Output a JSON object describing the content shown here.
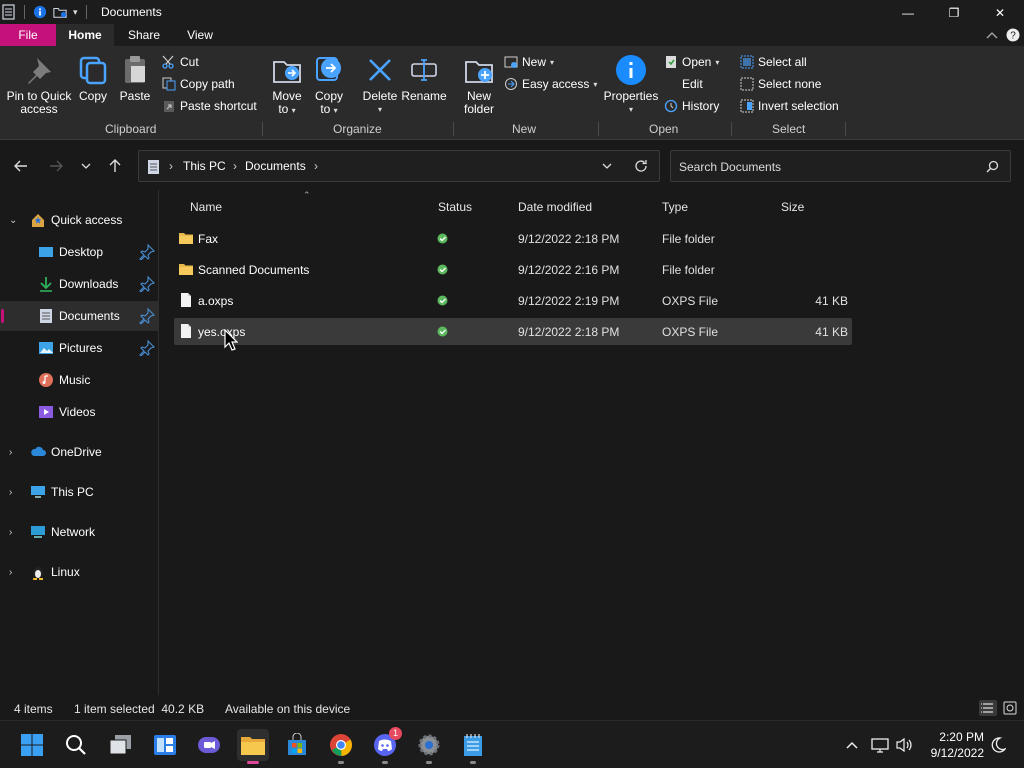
{
  "window": {
    "title": "Documents",
    "controls": {
      "minimize": "—",
      "maximize": "❐",
      "close": "✕"
    }
  },
  "ribbon": {
    "tabs": [
      "File",
      "Home",
      "Share",
      "View"
    ],
    "clipboard": {
      "label": "Clipboard",
      "pin": "Pin to Quick access",
      "copy": "Copy",
      "paste": "Paste",
      "cut": "Cut",
      "copy_path": "Copy path",
      "paste_shortcut": "Paste shortcut"
    },
    "organize": {
      "label": "Organize",
      "move_to_1": "Move",
      "move_to_2": "to",
      "copy_to_1": "Copy",
      "copy_to_2": "to",
      "delete": "Delete",
      "rename": "Rename"
    },
    "new": {
      "label": "New",
      "new_folder_1": "New",
      "new_folder_2": "folder",
      "new_item": "New",
      "easy_access": "Easy access"
    },
    "open": {
      "label": "Open",
      "properties": "Properties",
      "open": "Open",
      "edit": "Edit",
      "history": "History"
    },
    "select": {
      "label": "Select",
      "select_all": "Select all",
      "select_none": "Select none",
      "invert": "Invert selection"
    }
  },
  "address": {
    "crumbs": [
      "This PC",
      "Documents"
    ],
    "search_placeholder": "Search Documents"
  },
  "sidebar": {
    "items": [
      {
        "label": "Quick access",
        "icon": "star-icon"
      },
      {
        "label": "Desktop",
        "icon": "desktop-icon"
      },
      {
        "label": "Downloads",
        "icon": "download-icon"
      },
      {
        "label": "Documents",
        "icon": "document-icon"
      },
      {
        "label": "Pictures",
        "icon": "picture-icon"
      },
      {
        "label": "Music",
        "icon": "music-icon"
      },
      {
        "label": "Videos",
        "icon": "video-icon"
      },
      {
        "label": "OneDrive",
        "icon": "cloud-icon"
      },
      {
        "label": "This PC",
        "icon": "monitor-icon"
      },
      {
        "label": "Network",
        "icon": "network-icon"
      },
      {
        "label": "Linux",
        "icon": "linux-icon"
      }
    ]
  },
  "files": {
    "columns": [
      "Name",
      "Status",
      "Date modified",
      "Type",
      "Size"
    ],
    "rows": [
      {
        "name": "Fax",
        "date": "9/12/2022 2:18 PM",
        "type": "File folder",
        "size": ""
      },
      {
        "name": "Scanned Documents",
        "date": "9/12/2022 2:16 PM",
        "type": "File folder",
        "size": ""
      },
      {
        "name": "a.oxps",
        "date": "9/12/2022 2:19 PM",
        "type": "OXPS File",
        "size": "41 KB"
      },
      {
        "name": "yes.oxps",
        "date": "9/12/2022 2:18 PM",
        "type": "OXPS File",
        "size": "41 KB"
      }
    ]
  },
  "statusbar": {
    "count": "4 items",
    "selection": "1 item selected  40.2 KB",
    "availability": "Available on this device"
  },
  "taskbar": {
    "time": "2:20 PM",
    "date": "9/12/2022",
    "discord_badge": "1"
  },
  "colors": {
    "accent": "#c4127a",
    "background": "#191919",
    "ribbon": "#2b2b2b",
    "status_ok": "#5cb85c"
  }
}
